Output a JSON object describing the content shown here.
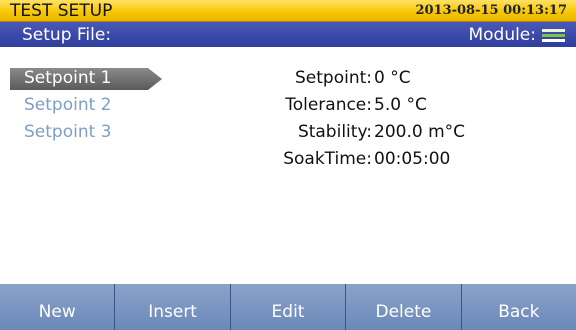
{
  "header": {
    "title": "TEST SETUP",
    "datetime": "2013-08-15 00:13:17"
  },
  "subheader": {
    "setup_file_label": "Setup File:",
    "module_label": "Module:",
    "module_icon": "module-indicator-icon"
  },
  "setpoints": [
    {
      "label": "Setpoint 1",
      "selected": true
    },
    {
      "label": "Setpoint 2",
      "selected": false
    },
    {
      "label": "Setpoint 3",
      "selected": false
    }
  ],
  "details": [
    {
      "key": "Setpoint:",
      "value": "0 °C"
    },
    {
      "key": "Tolerance:",
      "value": "5.0 °C"
    },
    {
      "key": "Stability:",
      "value": "200.0 m°C"
    },
    {
      "key": "SoakTime:",
      "value": "00:05:00"
    }
  ],
  "buttons": [
    "New",
    "Insert",
    "Edit",
    "Delete",
    "Back"
  ],
  "colors": {
    "title_bar": "#f7c600",
    "sub_bar": "#3a48a8",
    "selected_item_bg": "#6e6e6e",
    "unselected_item_text": "#7f9ec4",
    "button_bar": "#7a96c2"
  }
}
